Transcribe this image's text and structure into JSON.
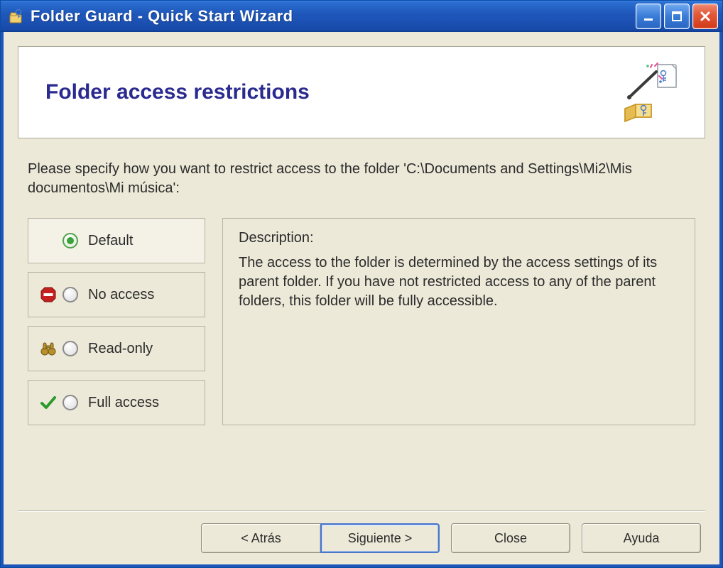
{
  "title": "Folder Guard - Quick Start Wizard",
  "header": {
    "page_title": "Folder access restrictions"
  },
  "instruction": "Please specify how you want to restrict access to the folder 'C:\\Documents and Settings\\Mi2\\Mis documentos\\Mi música':",
  "options": {
    "default_label": "Default",
    "no_access_label": "No access",
    "read_only_label": "Read-only",
    "full_access_label": "Full access"
  },
  "description": {
    "title": "Description:",
    "body": "The access to the folder is determined by the access settings of its parent folder. If you have not restricted access to any of the parent folders, this folder will be fully accessible."
  },
  "footer": {
    "back_label": "< Atrás",
    "next_label": "Siguiente >",
    "close_label": "Close",
    "help_label": "Ayuda"
  }
}
